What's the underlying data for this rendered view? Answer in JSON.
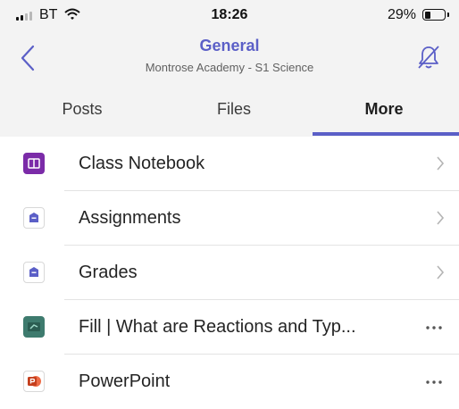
{
  "status_bar": {
    "carrier": "BT",
    "time": "18:26",
    "battery_percent": "29%",
    "battery_level": 0.29,
    "icons": [
      "signal-icon",
      "wifi-icon",
      "battery-icon"
    ]
  },
  "header": {
    "title": "General",
    "subtitle": "Montrose Academy - S1 Science",
    "icons": [
      "back-chevron-icon",
      "notifications-off-bell-icon"
    ]
  },
  "tabs": [
    {
      "label": "Posts",
      "active": false
    },
    {
      "label": "Files",
      "active": false
    },
    {
      "label": "More",
      "active": true
    }
  ],
  "list": [
    {
      "label": "Class Notebook",
      "icon": "onenote-icon",
      "trailing": "chevron-right-icon"
    },
    {
      "label": "Assignments",
      "icon": "assignments-icon",
      "trailing": "chevron-right-icon"
    },
    {
      "label": "Grades",
      "icon": "grades-icon",
      "trailing": "chevron-right-icon"
    },
    {
      "label": "Fill | What are Reactions and Typ...",
      "icon": "forms-icon",
      "trailing": "more-options-icon"
    },
    {
      "label": "PowerPoint",
      "icon": "powerpoint-icon",
      "trailing": "more-options-icon"
    }
  ],
  "colors": {
    "accent": "#5b5fc7",
    "header_background": "#f3f3f3",
    "onenote": "#7b2ba8",
    "powerpoint": "#c43e1c",
    "forms": "#3e7b6e"
  }
}
